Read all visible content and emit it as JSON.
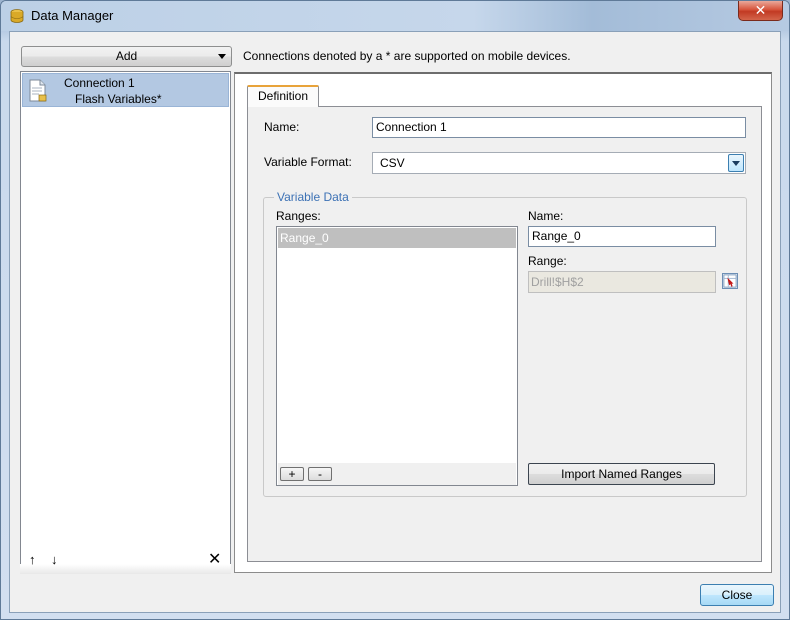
{
  "window": {
    "title": "Data Manager",
    "close_glyph": "✕"
  },
  "left": {
    "add_label": "Add",
    "connections": [
      {
        "name": "Connection 1",
        "type": "Flash Variables*"
      }
    ],
    "up_glyph": "↑",
    "down_glyph": "↓",
    "delete_glyph": "✕"
  },
  "info_text": "Connections denoted by a * are supported on mobile devices.",
  "definition": {
    "tab_label": "Definition",
    "name_label": "Name:",
    "name_value": "Connection 1",
    "format_label": "Variable Format:",
    "format_value": "CSV",
    "group_label": "Variable Data",
    "ranges_label": "Ranges:",
    "ranges": [
      "Range_0"
    ],
    "add_glyph": "+",
    "remove_glyph": "-",
    "range_name_label": "Name:",
    "range_name_value": "Range_0",
    "range_label": "Range:",
    "range_value": "Drill!$H$2",
    "import_label": "Import Named Ranges"
  },
  "footer": {
    "close_label": "Close"
  },
  "colors": {
    "selection": "#b3c8e2",
    "tab_accent": "#e8a33a",
    "group_legend": "#3d72b5"
  }
}
